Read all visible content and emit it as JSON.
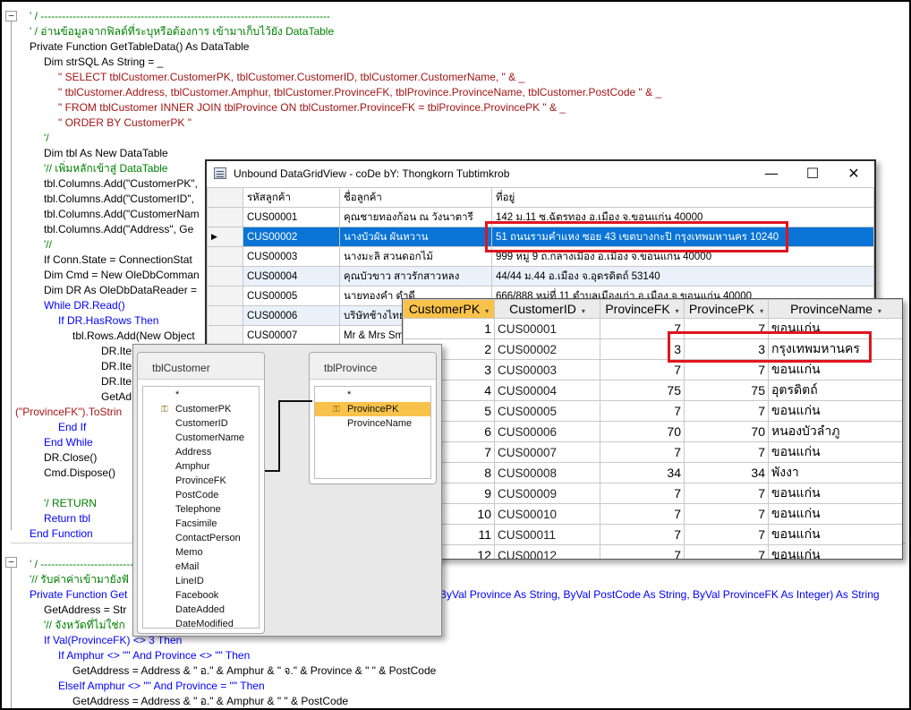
{
  "code": {
    "lines": [
      "' / ---------------------------------------------------------------------------------",
      "' / อ่านข้อมูลจากฟิลด์ที่ระบุหรือต้องการ เข้ามาเก็บไว้ยัง DataTable",
      "Private Function GetTableData() As DataTable",
      "Dim strSQL As String = _",
      "\" SELECT tblCustomer.CustomerPK, tblCustomer.CustomerID, tblCustomer.CustomerName, \" & _",
      "\" tblCustomer.Address, tblCustomer.Amphur, tblCustomer.ProvinceFK, tblProvince.ProvinceName, tblCustomer.PostCode \" & _",
      "\" FROM tblCustomer INNER JOIN tblProvince ON tblCustomer.ProvinceFK = tblProvince.ProvincePK \" & _",
      "\" ORDER BY CustomerPK \"",
      "'/",
      "Dim tbl As New DataTable",
      "'// เพิ่มหลักเข้าสู่ DataTable",
      "tbl.Columns.Add(\"CustomerPK\",",
      "tbl.Columns.Add(\"CustomerID\",",
      "tbl.Columns.Add(\"CustomerNam",
      "tbl.Columns.Add(\"Address\", Ge",
      "'//",
      "If Conn.State = ConnectionStat",
      "Dim Cmd = New OleDbComman",
      "Dim DR As OleDbDataReader =",
      "While DR.Read()",
      "If DR.HasRows Then",
      "tbl.Rows.Add(New Object",
      "DR.Ite",
      "DR.Ite",
      "DR.Ite",
      "GetAd",
      "(\"ProvinceFK\").ToStrin",
      "End If",
      "End While",
      "DR.Close()",
      "Cmd.Dispose()",
      "'/ RETURN",
      "Return tbl",
      "End Function",
      "' / -----------------------------",
      "'// รับค่าค่าเข้ามายังฟั",
      "Private Function Get",
      "ByVal Province As String, ByVal PostCode As String, ByVal ProvinceFK As Integer) As String",
      "GetAddress = Str",
      "'// จังหวัดที่ไม่ใช่ก",
      "If Val(ProvinceFK) <> 3 Then",
      "If Amphur <> \"\" And Province <> \"\" Then",
      "GetAddress = Address & \" อ.\" & Amphur & \" จ.\" & Province & \" \" & PostCode",
      "ElseIf Amphur <> \"\" And Province = \"\" Then",
      "GetAddress = Address & \" อ.\" & Amphur & \" \" & PostCode"
    ],
    "fold_glyph": "−"
  },
  "dgv_window": {
    "title": "Unbound DataGridView - coDe bY: Thongkorn Tubtimkrob",
    "minimize": "—",
    "maximize": "☐",
    "close": "✕",
    "columns": [
      "รหัสลูกค้า",
      "ชื่อลูกค้า",
      "ที่อยู่"
    ],
    "row_pointer": "▶",
    "rows": [
      {
        "id": "CUS00001",
        "name": "คุณชายทองก้อน ณ วังนาตารี",
        "address": "142 ม.11 ซ.ฉัตรทอง อ.เมือง จ.ขอนแก่น 40000"
      },
      {
        "id": "CUS00002",
        "name": "นางบัวผัน ผันหวาน",
        "address": "51 ถนนรามคำแหง ซอย 43 เขตบางกะปิ กรุงเทพมหานคร 10240"
      },
      {
        "id": "CUS00003",
        "name": "นางมะลิ สวนดอกไม้",
        "address": "999 หมู่ 9 ถ.กลางเมือง อ.เมือง จ.ขอนแก่น 40000"
      },
      {
        "id": "CUS00004",
        "name": "คุณบัวขาว สาวรักสาวหลง",
        "address": "44/44 ม.44 อ.เมือง จ.อุดรดิตถ์ 53140"
      },
      {
        "id": "CUS00005",
        "name": "นายทองคำ ดำดี",
        "address": "666/888 หมู่ที่ 11 ตำบลเมืองเก่า อ.เมือง จ.ขอนแก่น 40000"
      },
      {
        "id": "CUS00006",
        "name": "บริษัทช้างไทย",
        "address": ""
      },
      {
        "id": "CUS00007",
        "name": "Mr & Mrs Sm",
        "address": ""
      }
    ]
  },
  "access_table": {
    "headers": [
      "CustomerPK",
      "CustomerID",
      "ProvinceFK",
      "ProvincePK",
      "ProvinceName"
    ],
    "sort_arrow": "▾",
    "rows": [
      [
        "1",
        "CUS00001",
        "7",
        "7",
        "ขอนแก่น"
      ],
      [
        "2",
        "CUS00002",
        "3",
        "3",
        "กรุงเทพมหานคร"
      ],
      [
        "3",
        "CUS00003",
        "7",
        "7",
        "ขอนแก่น"
      ],
      [
        "4",
        "CUS00004",
        "75",
        "75",
        "อุตรดิตถ์"
      ],
      [
        "5",
        "CUS00005",
        "7",
        "7",
        "ขอนแก่น"
      ],
      [
        "6",
        "CUS00006",
        "70",
        "70",
        "หนองบัวลำภู"
      ],
      [
        "7",
        "CUS00007",
        "7",
        "7",
        "ขอนแก่น"
      ],
      [
        "8",
        "CUS00008",
        "34",
        "34",
        "พังงา"
      ],
      [
        "9",
        "CUS00009",
        "7",
        "7",
        "ขอนแก่น"
      ],
      [
        "10",
        "CUS00010",
        "7",
        "7",
        "ขอนแก่น"
      ],
      [
        "11",
        "CUS00011",
        "7",
        "7",
        "ขอนแก่น"
      ],
      [
        "12",
        "CUS00012",
        "7",
        "7",
        "ขอนแก่น"
      ],
      [
        "13",
        "CUS00013",
        "28",
        "28",
        "บุรีรัมย์"
      ]
    ]
  },
  "diagram": {
    "customer_table": {
      "title": "tblCustomer",
      "fields": [
        "*",
        "CustomerPK",
        "CustomerID",
        "CustomerName",
        "Address",
        "Amphur",
        "ProvinceFK",
        "PostCode",
        "Telephone",
        "Facsimile",
        "ContactPerson",
        "Memo",
        "eMail",
        "LineID",
        "Facebook",
        "DateAdded",
        "DateModified"
      ]
    },
    "province_table": {
      "title": "tblProvince",
      "fields": [
        "*",
        "ProvincePK",
        "ProvinceName"
      ]
    },
    "key_glyph": "⚿"
  }
}
